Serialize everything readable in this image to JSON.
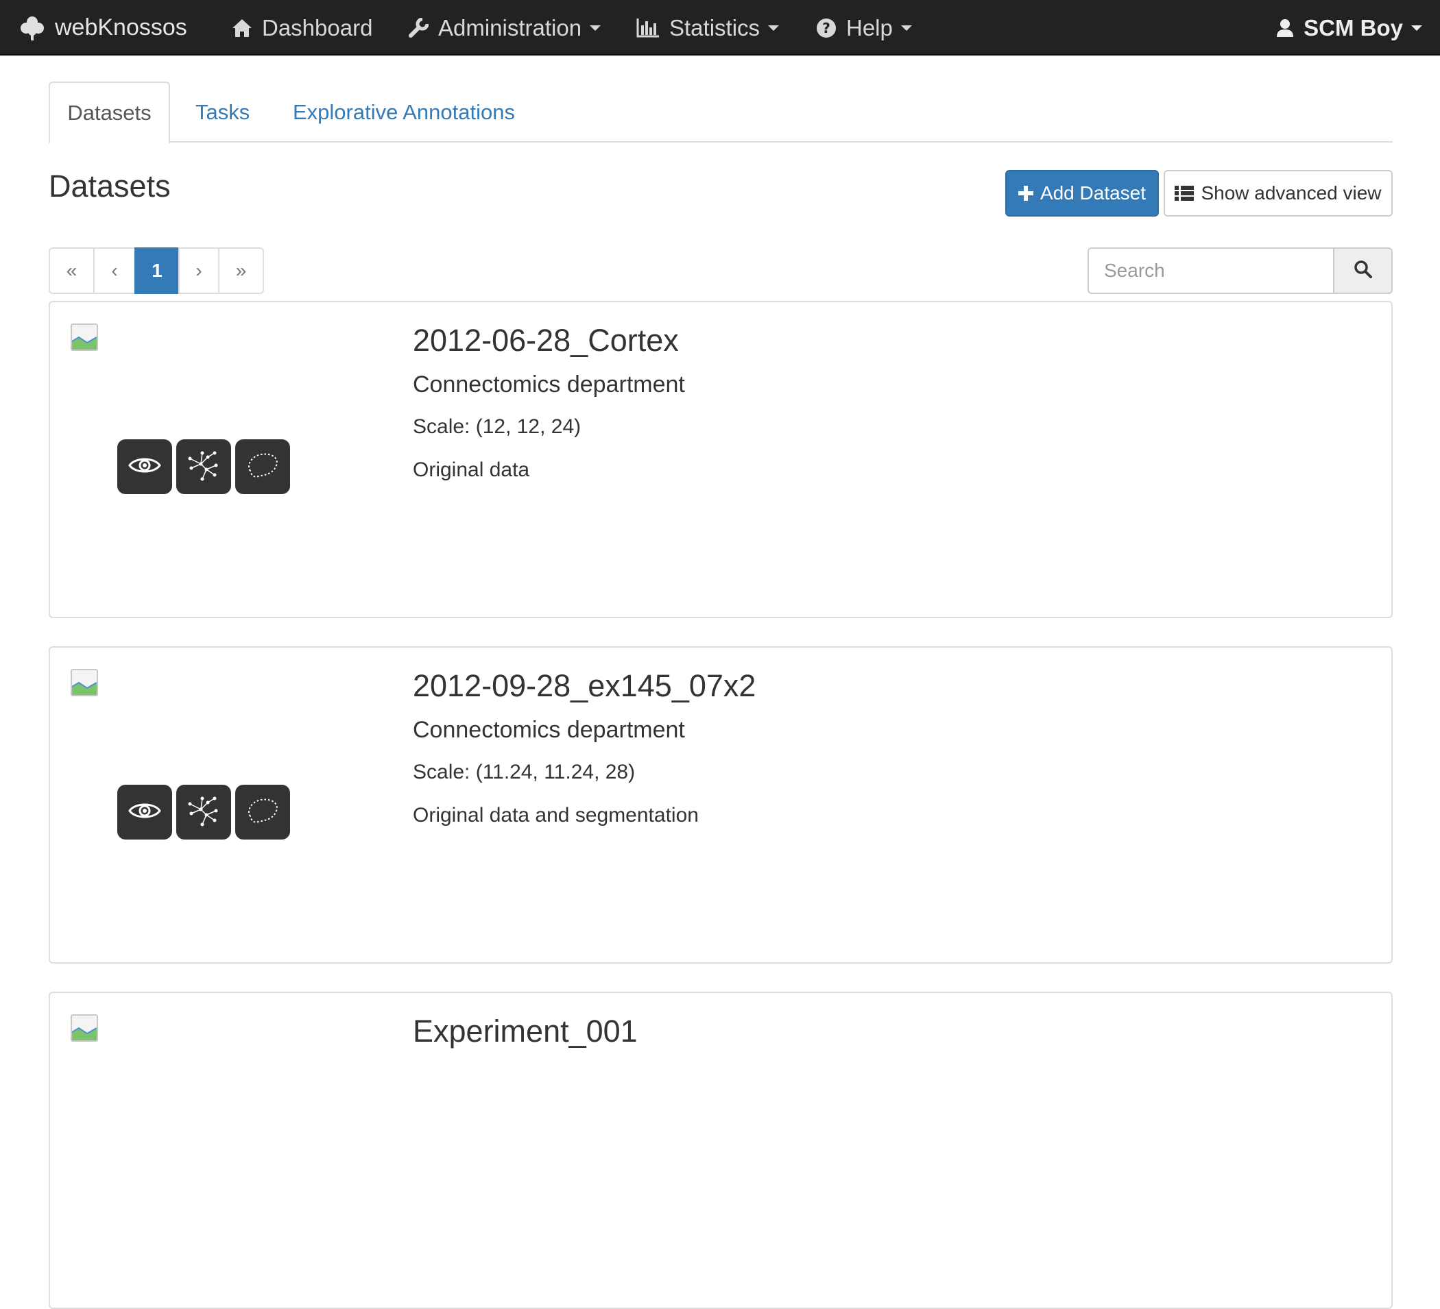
{
  "navbar": {
    "brand": "webKnossos",
    "brand_icon": "clover-icon",
    "items": [
      {
        "label": "Dashboard",
        "icon": "home-icon"
      },
      {
        "label": "Administration",
        "icon": "wrench-icon"
      },
      {
        "label": "Statistics",
        "icon": "bar-chart-icon"
      },
      {
        "label": "Help",
        "icon": "question-circle-icon"
      }
    ],
    "user": {
      "label": "SCM Boy",
      "icon": "user-icon"
    }
  },
  "tabs": [
    {
      "label": "Datasets",
      "active": true
    },
    {
      "label": "Tasks",
      "active": false
    },
    {
      "label": "Explorative Annotations",
      "active": false
    }
  ],
  "page": {
    "title": "Datasets",
    "add_button": "Add Dataset",
    "advanced_button": "Show advanced view"
  },
  "pagination": {
    "first": "«",
    "prev": "‹",
    "current": "1",
    "next": "›",
    "last": "»"
  },
  "search": {
    "placeholder": "Search"
  },
  "datasets": [
    {
      "name": "2012-06-28_Cortex",
      "owner": "Connectomics department",
      "scale": "Scale: (12, 12, 24)",
      "layers": "Original data"
    },
    {
      "name": "2012-09-28_ex145_07x2",
      "owner": "Connectomics department",
      "scale": "Scale: (11.24, 11.24, 28)",
      "layers": "Original data and segmentation"
    },
    {
      "name": "Experiment_001"
    }
  ],
  "colors": {
    "navbar_bg": "#222222",
    "primary": "#337ab7",
    "action_button_bg": "#333333",
    "border": "#dddddd"
  }
}
